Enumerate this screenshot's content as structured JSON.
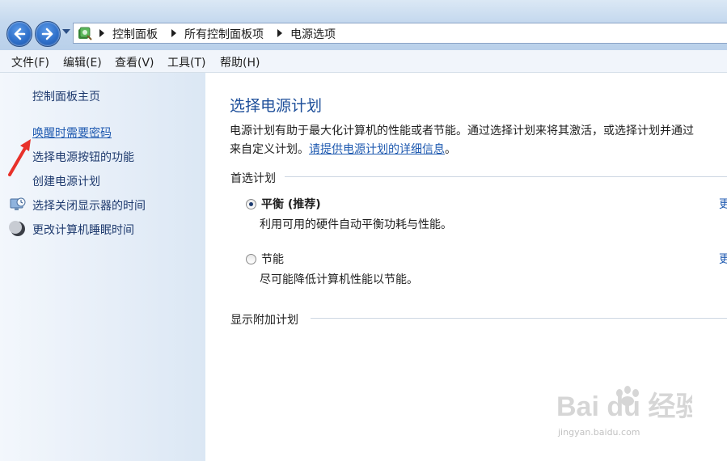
{
  "breadcrumb": [
    "控制面板",
    "所有控制面板项",
    "电源选项"
  ],
  "menu": [
    "文件(F)",
    "编辑(E)",
    "查看(V)",
    "工具(T)",
    "帮助(H)"
  ],
  "sidebar": {
    "home": "控制面板主页",
    "items": [
      {
        "label": "唤醒时需要密码",
        "icon": null,
        "link": true
      },
      {
        "label": "选择电源按钮的功能",
        "icon": null
      },
      {
        "label": "创建电源计划",
        "icon": null
      },
      {
        "label": "选择关闭显示器的时间",
        "icon": "monitor-clock-icon"
      },
      {
        "label": "更改计算机睡眠时间",
        "icon": "moon-icon"
      }
    ]
  },
  "main": {
    "title": "选择电源计划",
    "desc_line1": "电源计划有助于最大化计算机的性能或者节能。通过选择计划来将其激活，或选择计划并通过",
    "desc_line2_prefix": "来自定义计划。",
    "desc_link": "请提供电源计划的详细信息",
    "desc_line2_suffix": "。",
    "preferred_section": "首选计划",
    "plans": [
      {
        "name": "平衡 (推荐)",
        "desc": "利用可用的硬件自动平衡功耗与性能。",
        "selected": true,
        "side_link": "更"
      },
      {
        "name": "节能",
        "desc": "尽可能降低计算机性能以节能。",
        "selected": false,
        "side_link": "更"
      }
    ],
    "more_section": "显示附加计划"
  },
  "watermark": {
    "brand": "Bai du 经验",
    "url": "jingyan.baidu.com"
  },
  "colors": {
    "link": "#1f5ab0",
    "title": "#1e4f9a",
    "annotation": "#e8312a"
  }
}
